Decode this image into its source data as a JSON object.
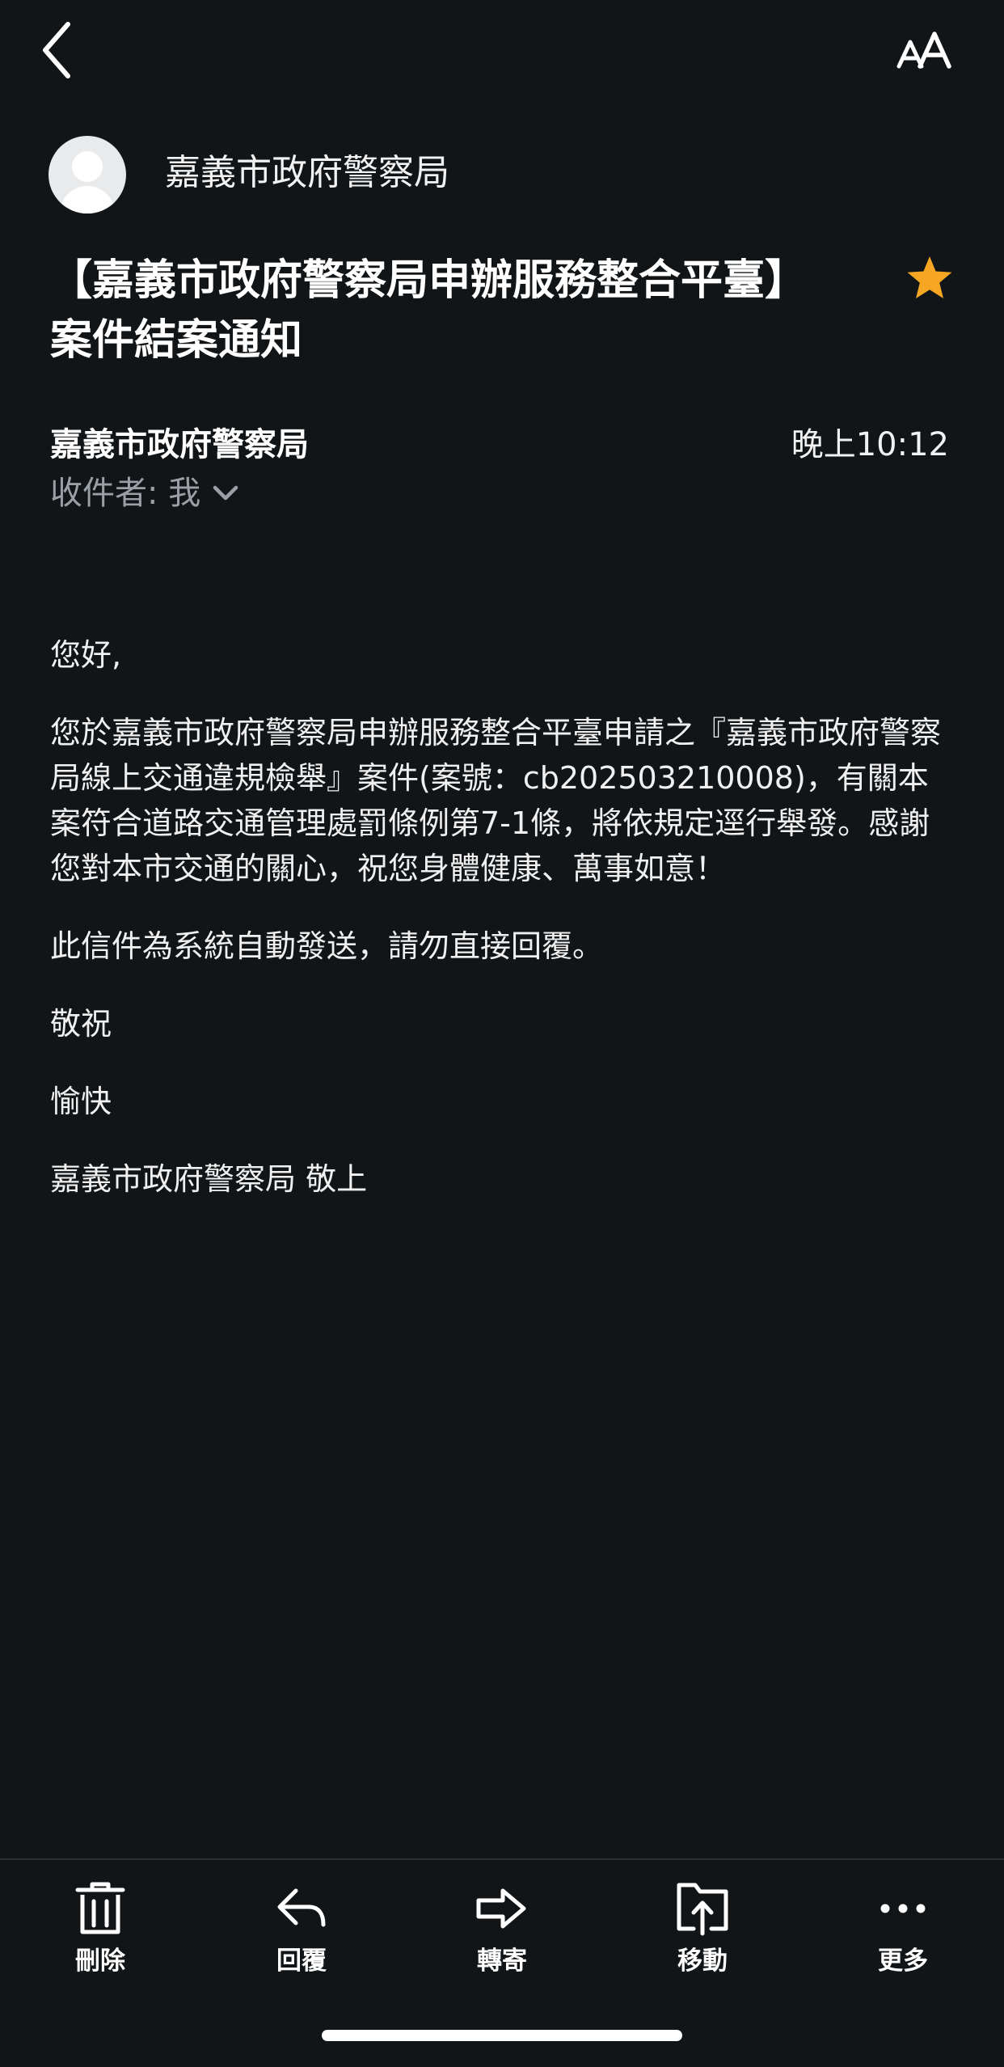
{
  "header": {
    "sender_display": "嘉義市政府警察局"
  },
  "email": {
    "subject_line1": "【嘉義市政府警察局申辦服務整合平臺】",
    "subject_line2": "案件結案通知",
    "starred": true,
    "from_name": "嘉義市政府警察局",
    "time": "晚上10:12",
    "recipient": "收件者: 我",
    "body": {
      "greeting": "您好,",
      "paragraph1": "您於嘉義市政府警察局申辦服務整合平臺申請之『嘉義市政府警察局線上交通違規檢舉』案件(案號：cb202503210008)，有關本案符合道路交通管理處罰條例第7-1條，將依規定逕行舉發。感謝您對本市交通的關心，祝您身體健康、萬事如意！",
      "notice": "此信件為系統自動發送，請勿直接回覆。",
      "closing1": "敬祝",
      "closing2": "愉快",
      "signature": "嘉義市政府警察局 敬上"
    }
  },
  "toolbar": {
    "delete_label": "刪除",
    "reply_label": "回覆",
    "forward_label": "轉寄",
    "move_label": "移動",
    "more_label": "更多"
  },
  "colors": {
    "background": "#111518",
    "star": "#f5a623",
    "muted_text": "#9aa0a6"
  },
  "icons": {
    "back": "chevron-left-icon",
    "text_size": "text-size-icon",
    "star": "star-icon",
    "delete": "trash-icon",
    "reply": "reply-icon",
    "forward": "forward-icon",
    "move": "move-folder-icon",
    "more": "more-icon"
  }
}
